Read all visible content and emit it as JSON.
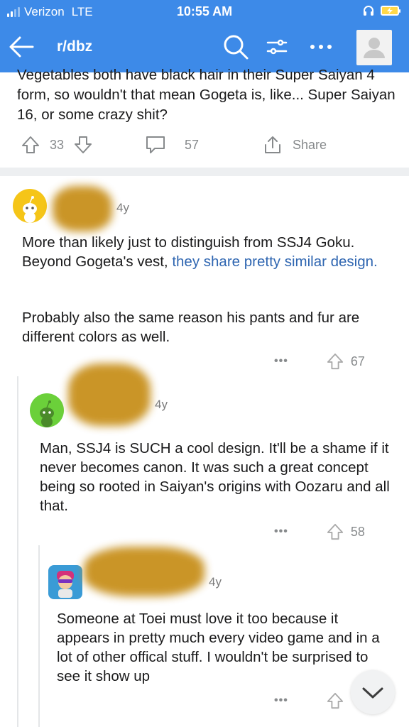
{
  "status_bar": {
    "carrier": "Verizon",
    "network": "LTE",
    "time": "10:55 AM"
  },
  "nav": {
    "subreddit": "r/dbz"
  },
  "post": {
    "body_text": "Vegetables both have black hair in their Super Saiyan 4 form, so wouldn't that mean Gogeta is, like... Super Saiyan 16, or some crazy shit?",
    "votes": "33",
    "comments": "57",
    "share_label": "Share"
  },
  "comments": [
    {
      "age": "4y",
      "avatar_color": "#f5c518",
      "paragraph1_start": "More than likely just to distinguish from SSJ4 Goku. Beyond Gogeta's vest, ",
      "paragraph1_link": "they share pretty similar design.",
      "paragraph2": "Probably also the same reason his pants and fur are different colors as well.",
      "more": "•••",
      "votes": "67"
    },
    {
      "age": "4y",
      "avatar_color": "#6bd03a",
      "text": "Man, SSJ4 is SUCH a cool design. It'll be a shame if it never becomes canon. It was such a great concept being so rooted in Saiyan's origins with Oozaru and all that.",
      "more": "•••",
      "votes": "58"
    },
    {
      "age": "4y",
      "avatar_color": "#3a9bd6",
      "text": "Someone at Toei must love it too because it appears in pretty much every video game and in a lot of other offical stuff. I wouldn't be surprised to see it show up",
      "more": "•••"
    }
  ],
  "colors": {
    "header": "#3d8ae8",
    "link": "#2f66b1",
    "meta": "#878a8c",
    "divider": "#edeff1"
  },
  "icons": [
    "back-arrow-icon",
    "search-icon",
    "filter-icon",
    "more-icon",
    "user-avatar-icon",
    "upvote-icon",
    "downvote-icon",
    "comment-icon",
    "share-icon",
    "chevron-down-icon",
    "headphones-icon",
    "battery-icon"
  ]
}
